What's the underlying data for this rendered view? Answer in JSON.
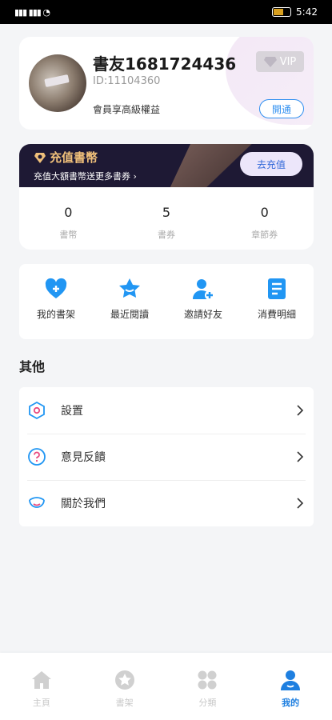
{
  "status_bar": {
    "signal_text": "▮▮▮ ▮▮▮ ◔",
    "time": "5:42",
    "battery": "85"
  },
  "profile": {
    "name": "書友1681724436",
    "id": "ID:11104360",
    "member_text": "會員享高級權益",
    "vip_label": "VIP",
    "open_button": "開通"
  },
  "recharge": {
    "title": "充值書幣",
    "subtitle": "充值大額書幣送更多書券",
    "button": "去充值",
    "stats": [
      {
        "value": "0",
        "label": "書幣"
      },
      {
        "value": "5",
        "label": "書券"
      },
      {
        "value": "0",
        "label": "章節券"
      }
    ]
  },
  "shortcuts": [
    {
      "label": "我的書架",
      "icon": "heart-plus-icon"
    },
    {
      "label": "最近閱讀",
      "icon": "star-cup-icon"
    },
    {
      "label": "邀請好友",
      "icon": "add-user-icon"
    },
    {
      "label": "消費明細",
      "icon": "document-icon"
    }
  ],
  "other": {
    "title": "其他",
    "items": [
      {
        "label": "設置",
        "icon": "settings-icon"
      },
      {
        "label": "意見反饋",
        "icon": "question-icon"
      },
      {
        "label": "關於我們",
        "icon": "smile-icon"
      }
    ]
  },
  "tabbar": [
    {
      "label": "主頁",
      "icon": "home-icon",
      "active": false
    },
    {
      "label": "書架",
      "icon": "star-circle-icon",
      "active": false
    },
    {
      "label": "分類",
      "icon": "grid-icon",
      "active": false
    },
    {
      "label": "我的",
      "icon": "profile-icon",
      "active": true
    }
  ],
  "colors": {
    "accent": "#1e7fe0",
    "banner": "#1e1934",
    "gold": "#f0c07a",
    "icon_blue": "#2196f3"
  }
}
